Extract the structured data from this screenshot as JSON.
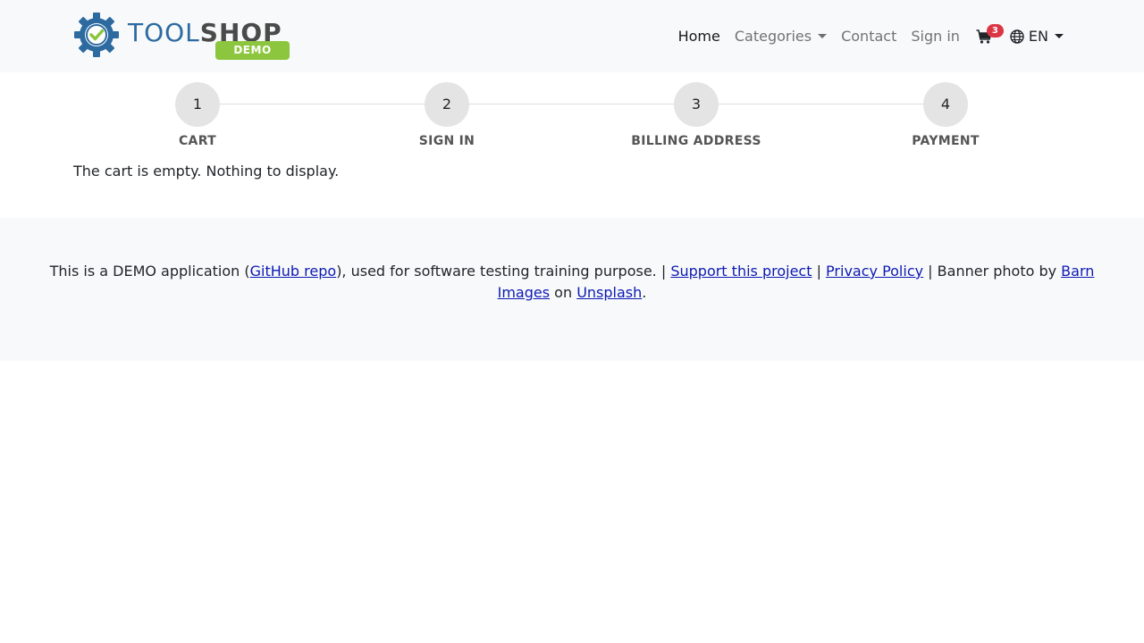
{
  "brand": {
    "name_part1": "TOOL",
    "name_part2": "SHOP",
    "badge": "DEMO",
    "colors": {
      "blue": "#2c6aa0",
      "green": "#8cc63f",
      "dark": "#4a4a4a"
    }
  },
  "nav": {
    "home": "Home",
    "categories": "Categories",
    "contact": "Contact",
    "sign_in": "Sign in",
    "cart_count": "3",
    "language": "EN"
  },
  "steps": [
    {
      "number": "1",
      "label": "CART"
    },
    {
      "number": "2",
      "label": "SIGN IN"
    },
    {
      "number": "3",
      "label": "BILLING ADDRESS"
    },
    {
      "number": "4",
      "label": "PAYMENT"
    }
  ],
  "cart": {
    "empty_message": "The cart is empty. Nothing to display."
  },
  "footer": {
    "text1": "This is a DEMO application (",
    "github_link": "GitHub repo",
    "text2": "), used for software testing training purpose. | ",
    "support_link": "Support this project",
    "text3": " | ",
    "privacy_link": "Privacy Policy",
    "text4": " | Banner photo by ",
    "barn_link": "Barn Images",
    "text5": " on ",
    "unsplash_link": "Unsplash",
    "text6": "."
  }
}
